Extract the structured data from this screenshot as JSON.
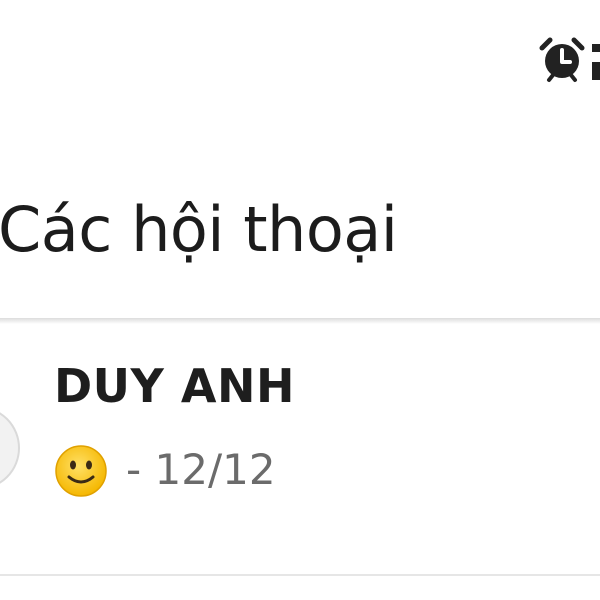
{
  "status_bar": {
    "icons": [
      "alarm-clock-icon",
      "status-indicator-icon"
    ]
  },
  "header": {
    "title": "Các hội thoại"
  },
  "conversations": [
    {
      "name": "DUY ANH",
      "preview_icon": "slightly-smiling-face-icon",
      "preview_text": "- 12/12"
    }
  ],
  "colors": {
    "title_text": "#1c1c1c",
    "name_text": "#1e1e1e",
    "preview_text": "#6b6b6b",
    "emoji_face": "#fcc21b",
    "divider": "#e6e6e6"
  }
}
